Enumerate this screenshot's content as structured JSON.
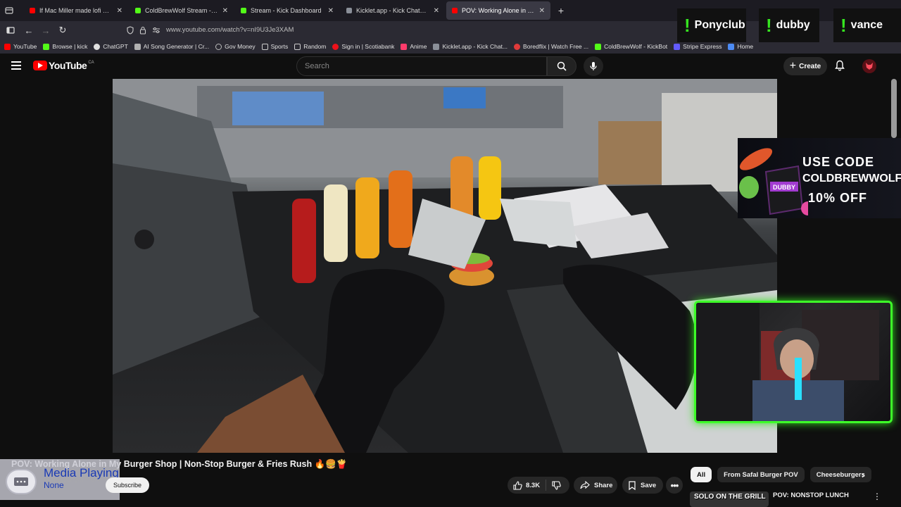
{
  "browser": {
    "tabs": [
      {
        "title": "If Mac Miller made lofi hip hop",
        "color": "#ff0000",
        "active": false
      },
      {
        "title": "ColdBrewWolf Stream - Watch Live",
        "color": "#53fc18",
        "active": false
      },
      {
        "title": "Stream - Kick Dashboard",
        "color": "#53fc18",
        "active": false
      },
      {
        "title": "Kicklet.app - Kick Chatbot and Streaming",
        "color": "#8a8f98",
        "active": false
      },
      {
        "title": "POV: Working Alone in My",
        "color": "#ff0000",
        "active": true
      }
    ],
    "url": "www.youtube.com/watch?v=nI9U3Je3XAM",
    "bookmarks": [
      {
        "label": "YouTube",
        "color": "#ff0000"
      },
      {
        "label": "Browse | kick",
        "color": "#53fc18"
      },
      {
        "label": "ChatGPT",
        "color": "#e0e0e0"
      },
      {
        "label": "AI Song Generator | Cr...",
        "color": "#b0b0b0"
      },
      {
        "label": "Gov Money",
        "color": "#bbbbbb"
      },
      {
        "label": "Sports",
        "color": "#cccccc"
      },
      {
        "label": "Random",
        "color": "#cccccc"
      },
      {
        "label": "Sign in | Scotiabank",
        "color": "#ec111a"
      },
      {
        "label": "Anime",
        "color": "#ff3b6b"
      },
      {
        "label": "Kicklet.app - Kick Chat...",
        "color": "#8a8f98"
      },
      {
        "label": "Boredflix | Watch Free ...",
        "color": "#e03a3a"
      },
      {
        "label": "ColdBrewWolf - KickBot",
        "color": "#53fc18"
      },
      {
        "label": "Stripe Express",
        "color": "#635bff"
      },
      {
        "label": "Home",
        "color": "#4c8bf5"
      }
    ]
  },
  "stream_overlay": {
    "tags": [
      "Ponyclub",
      "dubby",
      "vance"
    ],
    "ad": {
      "line1": "USE CODE",
      "line2": "COLDBREWWOLF",
      "line3": "10% OFF",
      "product": "DUBBY"
    }
  },
  "youtube": {
    "logo": "YouTube",
    "country": "CA",
    "search_placeholder": "Search",
    "create_label": "Create",
    "video_title": "POV: Working Alone in My Burger Shop | Non-Stop Burger & Fries Rush 🔥🍔🍟",
    "channel": "Safal Burger POV",
    "subscribe_label": "Subscribe",
    "likes": "8.3K",
    "share_label": "Share",
    "save_label": "Save",
    "chips": [
      "All",
      "From Safal Burger POV",
      "Cheeseburgers"
    ],
    "recommended": {
      "thumb_text": "SOLO ON THE GRILL",
      "title": "POV: NONSTOP LUNCH"
    }
  },
  "media_toast": {
    "title": "Media Playing",
    "subtitle": "None"
  }
}
